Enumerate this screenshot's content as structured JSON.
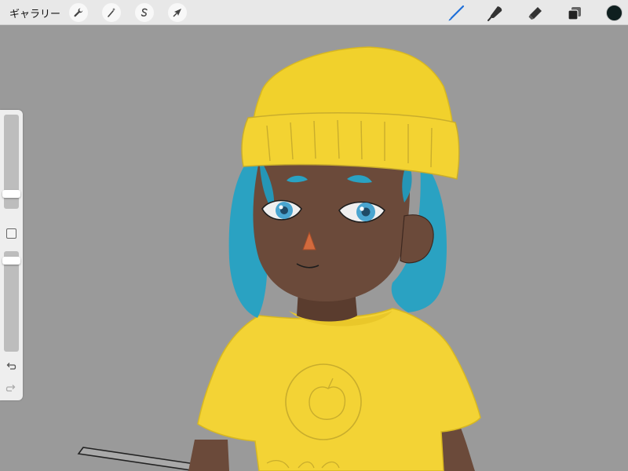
{
  "topbar": {
    "gallery_label": "ギャラリー",
    "left_tools": [
      {
        "name": "actions",
        "icon": "wrench-icon"
      },
      {
        "name": "adjustments",
        "icon": "magic-wand-icon"
      },
      {
        "name": "selection",
        "icon": "selection-s-icon"
      },
      {
        "name": "transform",
        "icon": "arrow-cursor-icon"
      }
    ],
    "right_tools": [
      {
        "name": "brush",
        "icon": "brush-icon",
        "active": true
      },
      {
        "name": "smudge",
        "icon": "smudge-icon"
      },
      {
        "name": "eraser",
        "icon": "eraser-icon"
      },
      {
        "name": "layers",
        "icon": "layers-icon"
      }
    ],
    "current_color": "#0f1f1f",
    "active_tool_color": "#1e6fd9"
  },
  "sidebar": {
    "brush_size_level": 0.2,
    "opacity_level": 0.95,
    "undo_icon": "undo-icon",
    "redo_icon": "redo-icon"
  },
  "canvas": {
    "background": "#9a9a9a",
    "artwork": "character-illustration",
    "colors": {
      "hat": "#f1d12c",
      "hair": "#2aa2c2",
      "skin": "#6b4a3a",
      "shirt": "#f3d335",
      "nose": "#d26a3d"
    }
  }
}
